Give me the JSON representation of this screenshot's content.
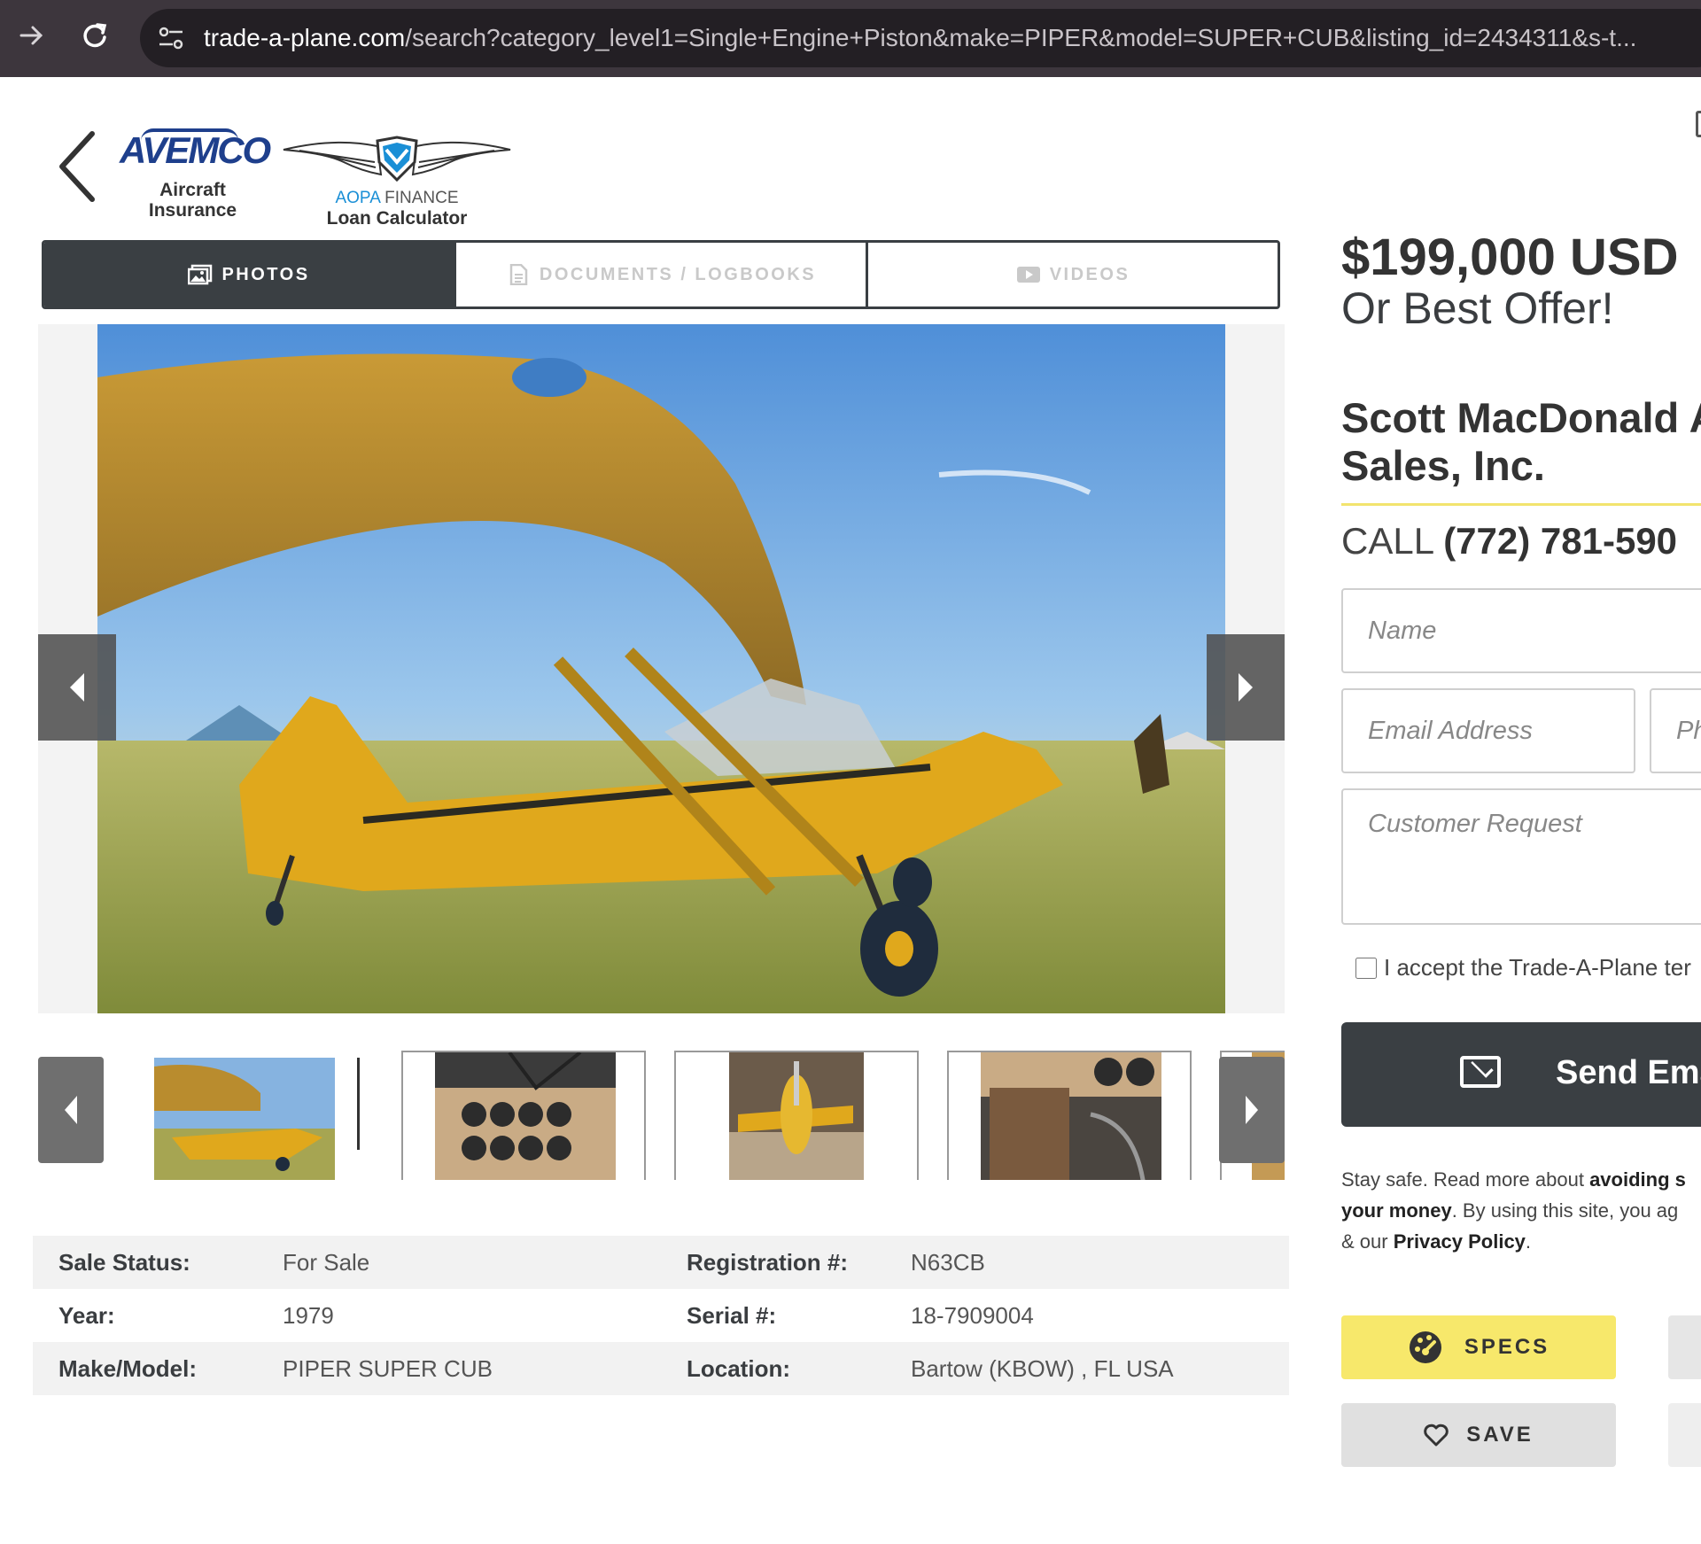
{
  "browser": {
    "url_host": "trade-a-plane.com",
    "url_rest": "/search?category_level1=Single+Engine+Piston&make=PIPER&model=SUPER+CUB&listing_id=2434311&s-t...",
    "forward_icon": "arrow-right-icon",
    "reload_icon": "reload-icon"
  },
  "header": {
    "avemco_logo": "AVEMCO",
    "avemco_caption_1": "Aircraft",
    "avemco_caption_2": "Insurance",
    "aopa_brand": "AOPA",
    "aopa_finance": "FINANCE",
    "aopa_caption": "Loan Calculator"
  },
  "media_tabs": [
    {
      "label": "PHOTOS",
      "icon": "image-icon",
      "active": true
    },
    {
      "label": "DOCUMENTS / LOGBOOKS",
      "icon": "document-icon",
      "active": false
    },
    {
      "label": "VIDEOS",
      "icon": "video-icon",
      "active": false
    }
  ],
  "specs": {
    "sale_status_label": "Sale Status:",
    "sale_status": "For Sale",
    "registration_label": "Registration #:",
    "registration": "N63CB",
    "year_label": "Year:",
    "year": "1979",
    "serial_label": "Serial #:",
    "serial": "18-7909004",
    "make_model_label": "Make/Model:",
    "make_model": "PIPER SUPER CUB",
    "location_label": "Location:",
    "location": "Bartow (KBOW) , FL USA"
  },
  "listing": {
    "price": "$199,000 USD",
    "price_note": "Or Best Offer!",
    "dealer_line1": "Scott MacDonald A",
    "dealer_line2": "Sales, Inc.",
    "call_label": "CALL",
    "phone": "(772) 781-590"
  },
  "form": {
    "name_placeholder": "Name",
    "email_placeholder": "Email Address",
    "phone_placeholder": "Ph",
    "request_placeholder": "Customer Request",
    "terms_label": "I accept the Trade-A-Plane ter",
    "send_label": "Send Ema",
    "send_icon": "envelope-icon"
  },
  "safety": {
    "line1_text": "Stay safe. Read more about ",
    "line1_bold": "avoiding s",
    "line2_bold": "your money",
    "line2_text": ". By using this site, you ag",
    "line3_text": "& our ",
    "line3_bold": "Privacy Policy",
    "line3_end": "."
  },
  "actions": {
    "specs_label": "SPECS",
    "specs_icon": "gauge-icon",
    "save_label": "SAVE",
    "save_icon": "heart-icon"
  },
  "colors": {
    "browser_bar": "#3d363d",
    "tab_active": "#3a3f43",
    "specs_button": "#f7e86b",
    "aircraft_yellow": "#e0a81c"
  }
}
